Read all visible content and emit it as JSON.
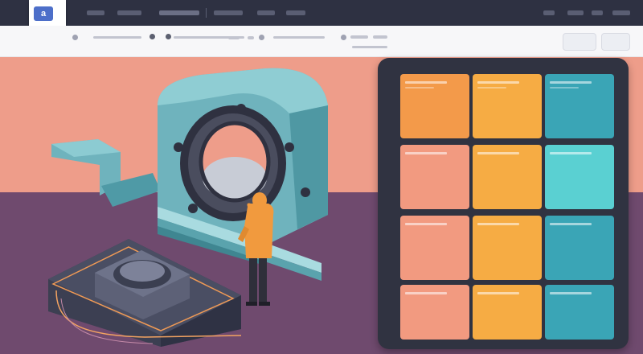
{
  "nav": {
    "items": [
      "",
      "",
      "",
      "",
      "",
      ""
    ],
    "right_items": [
      "",
      "",
      ""
    ]
  },
  "logo": {
    "mark": "a",
    "text": ""
  },
  "toolbar": {
    "buttons": [
      "",
      "",
      ""
    ]
  },
  "colors": {
    "topbar": "#2e3142",
    "hero_upper": "#ee9d8a",
    "hero_lower": "#6f4a6e",
    "panel": "#303341",
    "orange": "#f39a4a",
    "amber": "#f6ac44",
    "teal": "#3aa5b6",
    "salmon": "#f29a80",
    "cyan": "#5ad0d2",
    "machine_teal": "#6fb3bd",
    "worker_orange": "#f19a3e"
  },
  "illustration": {
    "subject": "ct-scanner-machine",
    "figure": "technician-in-orange-vest"
  },
  "tiles": [
    {
      "row": 1,
      "col": 1,
      "color": "orange"
    },
    {
      "row": 1,
      "col": 2,
      "color": "amber"
    },
    {
      "row": 1,
      "col": 3,
      "color": "teal"
    },
    {
      "row": 2,
      "col": 1,
      "color": "salmon"
    },
    {
      "row": 2,
      "col": 2,
      "color": "amber"
    },
    {
      "row": 2,
      "col": 3,
      "color": "cyan"
    },
    {
      "row": 3,
      "col": 1,
      "color": "salmon"
    },
    {
      "row": 3,
      "col": 2,
      "color": "amber"
    },
    {
      "row": 3,
      "col": 3,
      "color": "teal"
    },
    {
      "row": 4,
      "col": 1,
      "color": "salmon"
    },
    {
      "row": 4,
      "col": 2,
      "color": "amber"
    },
    {
      "row": 4,
      "col": 3,
      "color": "teal"
    }
  ]
}
